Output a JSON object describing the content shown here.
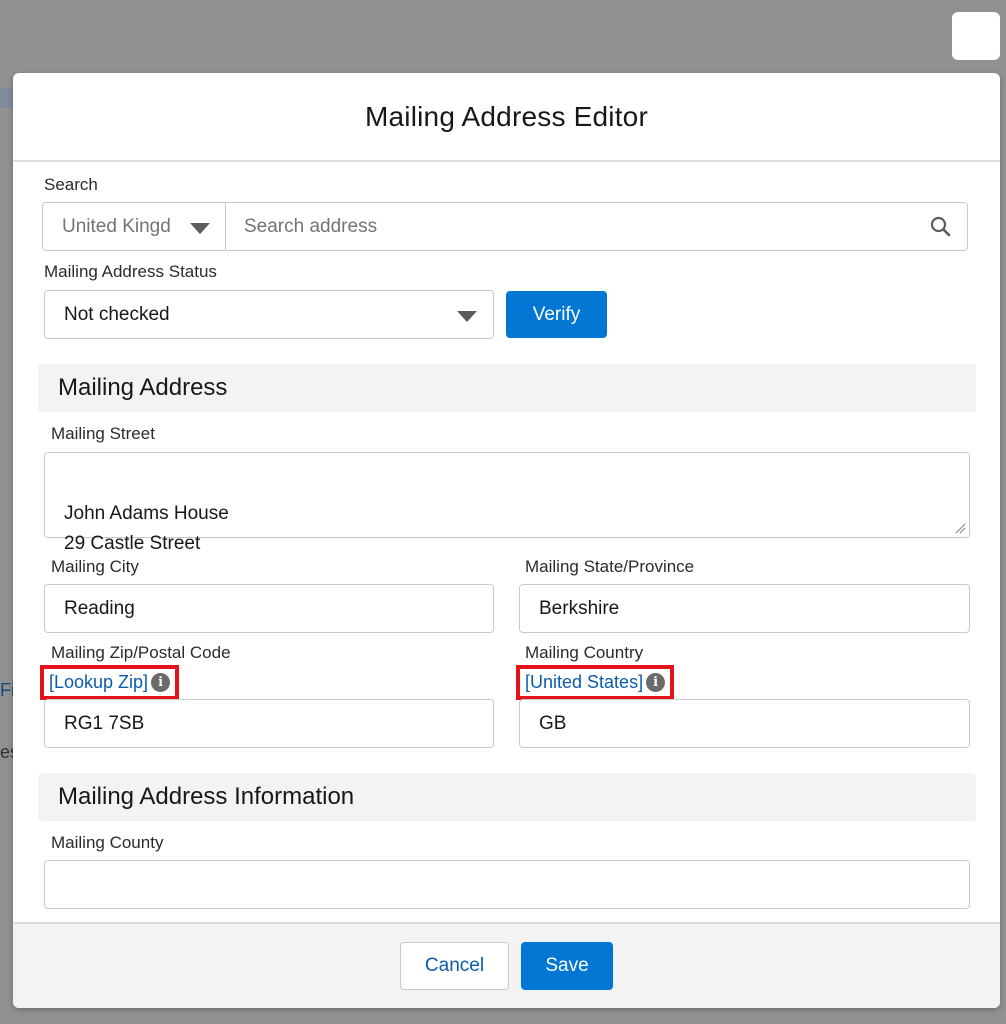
{
  "modal": {
    "title": "Mailing Address Editor"
  },
  "search": {
    "label": "Search",
    "country_value": "United Kingd",
    "placeholder": "Search address"
  },
  "status": {
    "label": "Mailing Address Status",
    "value": "Not checked",
    "verify_label": "Verify"
  },
  "mailing_address": {
    "section_title": "Mailing Address",
    "street_label": "Mailing Street",
    "street_value": "John Adams House\n29 Castle Street",
    "city_label": "Mailing City",
    "city_value": "Reading",
    "state_label": "Mailing State/Province",
    "state_value": "Berkshire",
    "zip_label": "Mailing Zip/Postal Code",
    "zip_link": "[Lookup Zip]",
    "zip_value": "RG1 7SB",
    "country_label": "Mailing Country",
    "country_link": "[United States]",
    "country_value": "GB"
  },
  "address_info": {
    "section_title": "Mailing Address Information",
    "county_label": "Mailing County",
    "county_value": ""
  },
  "footer": {
    "cancel_label": "Cancel",
    "save_label": "Save"
  },
  "background": {
    "fragment_1": "Fil",
    "fragment_2": "es"
  },
  "colors": {
    "brand": "#0176d3",
    "link": "#0b5cab",
    "highlight": "#e3121b",
    "overlay": "#919191"
  }
}
